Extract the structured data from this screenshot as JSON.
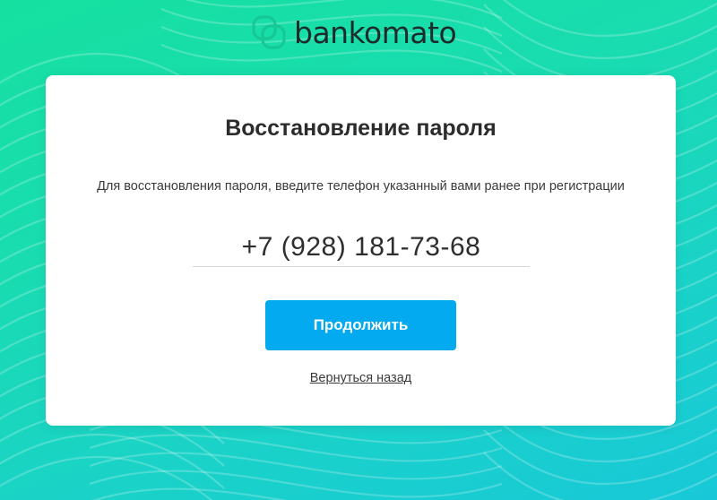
{
  "brand": {
    "name": "bankomato",
    "icon": "bankomato-logo-icon",
    "accent_color": "#16c896"
  },
  "card": {
    "title": "Восстановление пароля",
    "subtitle": "Для восстановления пароля, введите телефон указанный вами ранее при регистрации",
    "phone_value": "+7 (928) 181-73-68",
    "continue_label": "Продолжить",
    "back_label": "Вернуться назад"
  },
  "colors": {
    "button": "#04aaf0",
    "background_start": "#16e0a0",
    "background_end": "#18c8d8"
  }
}
